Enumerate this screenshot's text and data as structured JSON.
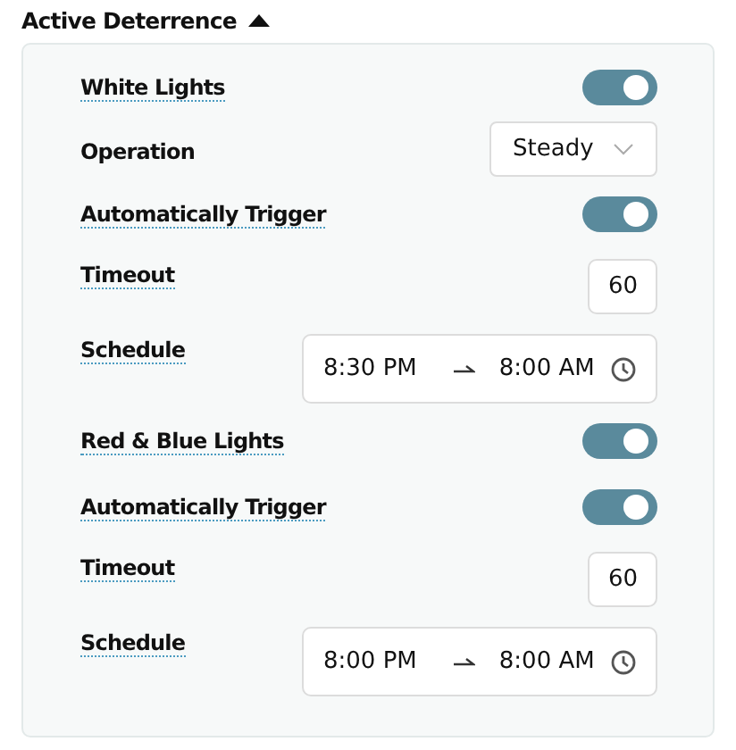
{
  "section": {
    "title": "Active Deterrence",
    "expanded": true
  },
  "rows": [
    {
      "kind": "toggle",
      "label": "White Lights",
      "tooltip": true,
      "on": true
    },
    {
      "kind": "select",
      "label": "Operation",
      "tooltip": false,
      "value": "Steady"
    },
    {
      "kind": "toggle",
      "label": "Automatically Trigger",
      "tooltip": true,
      "on": true
    },
    {
      "kind": "number",
      "label": "Timeout",
      "tooltip": true,
      "value": "60"
    },
    {
      "kind": "schedule",
      "label": "Schedule",
      "tooltip": true,
      "start": "8:30 PM",
      "end": "8:00 AM"
    },
    {
      "kind": "toggle",
      "label": "Red & Blue Lights",
      "tooltip": true,
      "on": true
    },
    {
      "kind": "toggle",
      "label": "Automatically Trigger",
      "tooltip": true,
      "on": true
    },
    {
      "kind": "number",
      "label": "Timeout",
      "tooltip": true,
      "value": "60"
    },
    {
      "kind": "schedule",
      "label": "Schedule",
      "tooltip": true,
      "start": "8:00 PM",
      "end": "8:00 AM"
    }
  ]
}
